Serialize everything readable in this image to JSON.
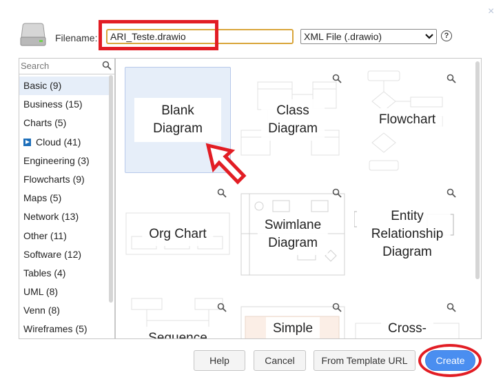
{
  "dialog": {
    "close_glyph": "×",
    "filename_label": "Filename:",
    "filename_value": "ARI_Teste.drawio",
    "file_type": "XML File (.drawio)",
    "help_glyph": "?"
  },
  "sidebar": {
    "search_placeholder": "Search",
    "categories": [
      {
        "label": "Basic (9)"
      },
      {
        "label": "Business (15)"
      },
      {
        "label": "Charts (5)"
      },
      {
        "label": "Cloud (41)"
      },
      {
        "label": "Engineering (3)"
      },
      {
        "label": "Flowcharts (9)"
      },
      {
        "label": "Maps (5)"
      },
      {
        "label": "Network (13)"
      },
      {
        "label": "Other (11)"
      },
      {
        "label": "Software (12)"
      },
      {
        "label": "Tables (4)"
      },
      {
        "label": "UML (8)"
      },
      {
        "label": "Venn (8)"
      },
      {
        "label": "Wireframes (5)"
      }
    ]
  },
  "templates": [
    {
      "line1": "Blank",
      "line2": "Diagram"
    },
    {
      "line1": "Class",
      "line2": "Diagram"
    },
    {
      "line1": "Flowchart"
    },
    {
      "line1": "Org Chart"
    },
    {
      "line1": "Swimlane",
      "line2": "Diagram"
    },
    {
      "line1": "Entity",
      "line2": "Relationship",
      "line3": "Diagram"
    },
    {
      "line1": "Sequence"
    },
    {
      "line1": "Simple"
    },
    {
      "line1": "Cross-"
    }
  ],
  "buttons": {
    "help": "Help",
    "cancel": "Cancel",
    "from_template_url": "From Template URL",
    "create": "Create"
  },
  "colors": {
    "accent_blue": "#4a8ef0",
    "highlight_red": "#e21d24",
    "selected_tile": "#e6eef9",
    "input_border": "#d9a53a"
  }
}
